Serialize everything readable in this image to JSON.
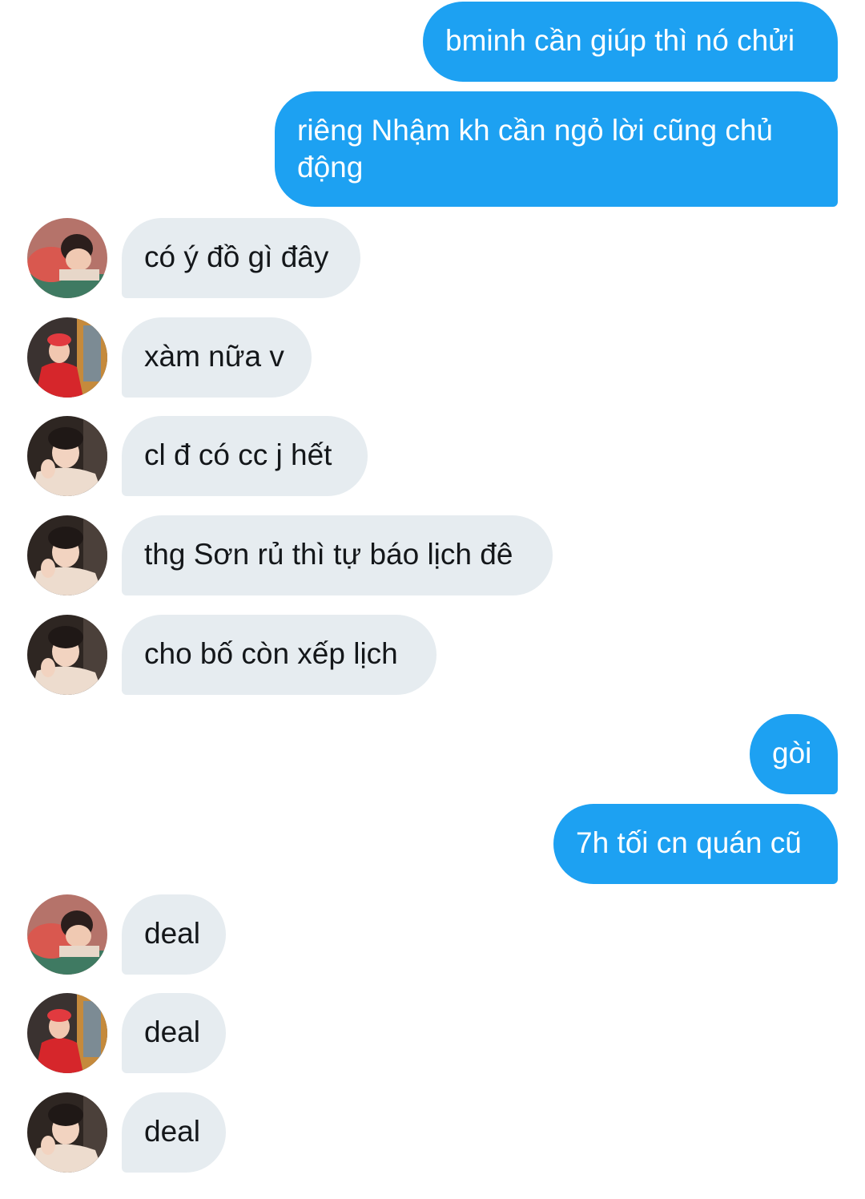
{
  "messages": [
    {
      "side": "out",
      "text": "bminh cần giúp thì nó chửi"
    },
    {
      "side": "out",
      "text": "riêng Nhậm kh cần ngỏ lời cũng chủ động"
    },
    {
      "side": "in",
      "avatar": "avatar-a",
      "text": "có ý đồ gì đây"
    },
    {
      "side": "in",
      "avatar": "avatar-b",
      "text": "xàm nữa v"
    },
    {
      "side": "in",
      "avatar": "avatar-c",
      "text": "cl đ có cc j hết"
    },
    {
      "side": "in",
      "avatar": "avatar-c",
      "text": "thg Sơn rủ thì tự báo lịch đê"
    },
    {
      "side": "in",
      "avatar": "avatar-c",
      "text": "cho bố còn xếp lịch"
    },
    {
      "side": "out",
      "text": "gòi"
    },
    {
      "side": "out",
      "text": "7h tối cn quán cũ"
    },
    {
      "side": "in",
      "avatar": "avatar-a",
      "text": "deal"
    },
    {
      "side": "in",
      "avatar": "avatar-b",
      "text": "deal"
    },
    {
      "side": "in",
      "avatar": "avatar-c",
      "text": "deal"
    }
  ],
  "colors": {
    "outgoing_bubble": "#1da1f2",
    "incoming_bubble": "#e6ecf0",
    "outgoing_text": "#ffffff",
    "incoming_text": "#14171a"
  }
}
